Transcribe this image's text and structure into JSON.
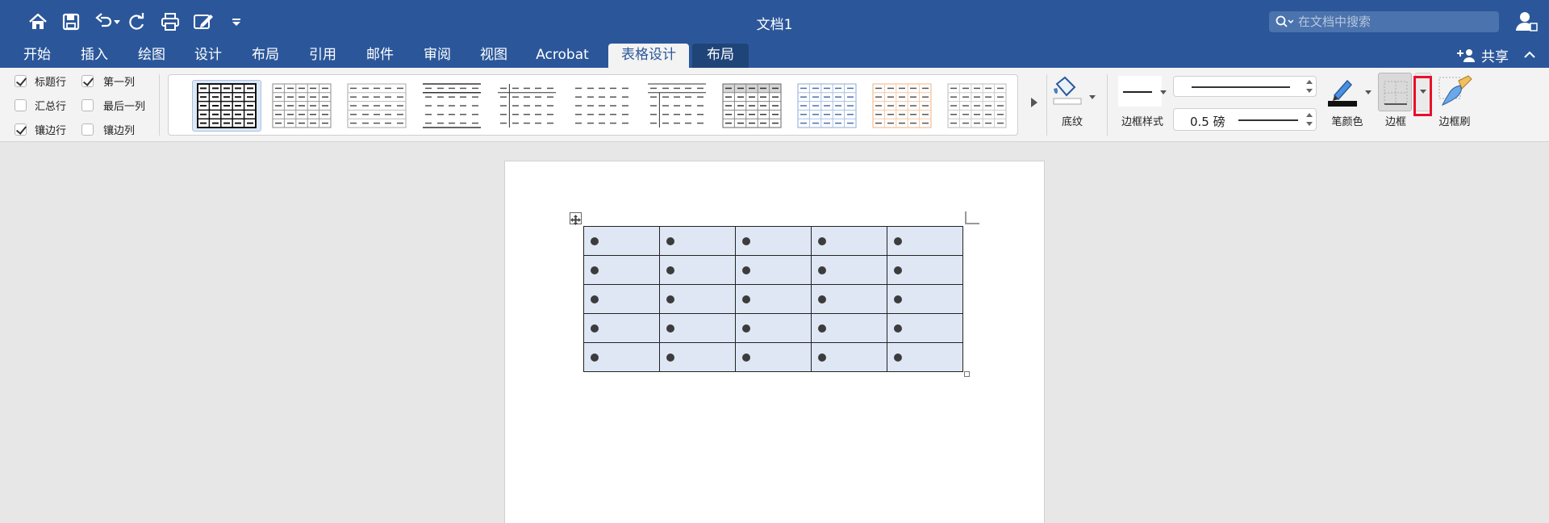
{
  "window": {
    "title": "文档1",
    "search_placeholder": "在文档中搜索"
  },
  "qat": {
    "icons": [
      "home-icon",
      "save-icon",
      "undo-icon",
      "redo-icon",
      "print-icon",
      "edit-doc-icon",
      "customize-qat-icon"
    ]
  },
  "tabs": [
    {
      "label": "开始"
    },
    {
      "label": "插入"
    },
    {
      "label": "绘图"
    },
    {
      "label": "设计"
    },
    {
      "label": "布局"
    },
    {
      "label": "引用"
    },
    {
      "label": "邮件"
    },
    {
      "label": "审阅"
    },
    {
      "label": "视图"
    },
    {
      "label": "Acrobat"
    },
    {
      "label": "表格设计",
      "active": true
    },
    {
      "label": "布局",
      "contextual": true
    }
  ],
  "share_label": "共享",
  "style_options": {
    "header_row": {
      "label": "标题行",
      "checked": true
    },
    "total_row": {
      "label": "汇总行",
      "checked": false
    },
    "banded_rows": {
      "label": "镶边行",
      "checked": true
    },
    "first_column": {
      "label": "第一列",
      "checked": true
    },
    "last_column": {
      "label": "最后一列",
      "checked": false
    },
    "banded_columns": {
      "label": "镶边列",
      "checked": false
    }
  },
  "gallery": {
    "item_count": 11,
    "selected_index": 0
  },
  "ribbon": {
    "shading_label": "底纹",
    "border_styles_label": "边框样式",
    "pen_weight": "0.5 磅",
    "pen_color_label": "笔颜色",
    "borders_label": "边框",
    "border_painter_label": "边框刷"
  },
  "colors": {
    "brand": "#2b579a",
    "table_fill": "#dfe7f5",
    "highlight": "#e8102b"
  },
  "document": {
    "table_rows": 5,
    "table_cols": 5,
    "cell_glyph": "●"
  }
}
